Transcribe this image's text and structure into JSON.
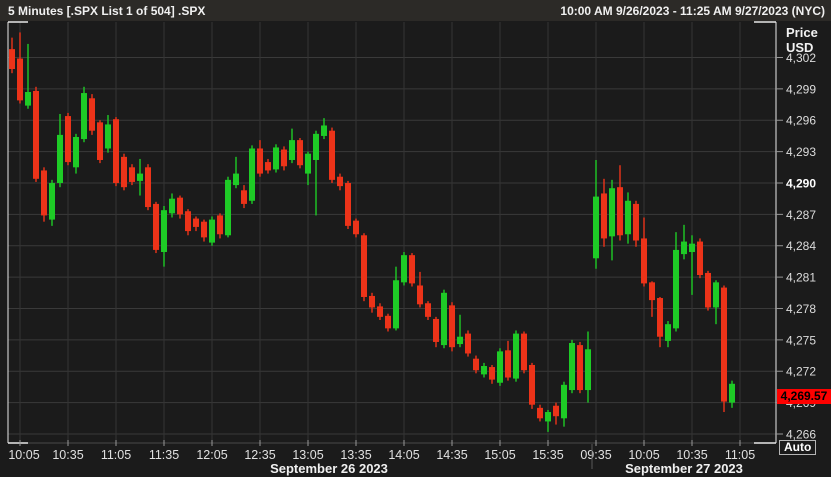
{
  "window": {
    "title": "5 Minutes [.SPX List 1 of 504] .SPX",
    "date_range": "10:00 AM 9/26/2023 - 11:25 AM 9/27/2023 (NYC)"
  },
  "price_axis": {
    "title_line1": "Price",
    "title_line2": "USD",
    "emphasized_tick": "4,290",
    "last_price": "4,269.57",
    "auto_button": "Auto",
    "ticks": [
      {
        "price": 4302,
        "label": "4,302"
      },
      {
        "price": 4299,
        "label": "4,299"
      },
      {
        "price": 4296,
        "label": "4,296"
      },
      {
        "price": 4293,
        "label": "4,293"
      },
      {
        "price": 4290,
        "label": "4,290"
      },
      {
        "price": 4287,
        "label": "4,287"
      },
      {
        "price": 4284,
        "label": "4,284"
      },
      {
        "price": 4281,
        "label": "4,281"
      },
      {
        "price": 4278,
        "label": "4,278"
      },
      {
        "price": 4275,
        "label": "4,275"
      },
      {
        "price": 4272,
        "label": "4,272"
      },
      {
        "price": 4269,
        "label": "4,269"
      },
      {
        "price": 4266,
        "label": "4,266"
      }
    ]
  },
  "time_axis": {
    "ticks": [
      {
        "slot": 1,
        "label": "10:05"
      },
      {
        "slot": 7,
        "label": "10:35"
      },
      {
        "slot": 13,
        "label": "11:05"
      },
      {
        "slot": 19,
        "label": "11:35"
      },
      {
        "slot": 25,
        "label": "12:05"
      },
      {
        "slot": 31,
        "label": "12:35"
      },
      {
        "slot": 37,
        "label": "13:05"
      },
      {
        "slot": 43,
        "label": "13:35"
      },
      {
        "slot": 49,
        "label": "14:05"
      },
      {
        "slot": 55,
        "label": "14:35"
      },
      {
        "slot": 61,
        "label": "15:05"
      },
      {
        "slot": 67,
        "label": "15:35"
      },
      {
        "slot": 73,
        "label": "09:35"
      },
      {
        "slot": 79,
        "label": "10:05"
      },
      {
        "slot": 85,
        "label": "10:35"
      },
      {
        "slot": 91,
        "label": "11:05"
      }
    ],
    "sessions": [
      {
        "date_label": "September 26 2023"
      },
      {
        "date_label": "September 27 2023"
      }
    ],
    "session_break_after_slot": 72
  },
  "colors": {
    "background": "#1b1b1b",
    "header_bg": "#2c2a27",
    "up": "#1ecb26",
    "down": "#ec3319",
    "grid_h": "#3a3a3a",
    "grid_v": "#343434",
    "frame": "#e8e8e8",
    "axis_line": "#4a4a4a",
    "tick_mark": "#979797",
    "tick_text": "#dcdcdc",
    "badge_bg": "#fe0100",
    "badge_text": "#000000"
  },
  "chart_data": {
    "type": "candlestick",
    "instrument": ".SPX",
    "interval": "5 Minutes",
    "price_unit": "USD",
    "ylim": [
      4265.1,
      4305.4
    ],
    "total_slots": 96,
    "columns": [
      "time",
      "open",
      "high",
      "low",
      "close"
    ],
    "candles": [
      [
        "10:00",
        4302.8,
        4303.9,
        4300.5,
        4300.9
      ],
      [
        "10:05",
        4301.9,
        4304.4,
        4297.6,
        4297.9
      ],
      [
        "10:10",
        4297.4,
        4303.3,
        4297.1,
        4298.7
      ],
      [
        "10:15",
        4298.8,
        4299.2,
        4290.1,
        4290.4
      ],
      [
        "10:20",
        4291.2,
        4291.5,
        4286.3,
        4286.9
      ],
      [
        "10:25",
        4286.5,
        4290.3,
        4285.9,
        4290.0
      ],
      [
        "10:30",
        4290.0,
        4296.6,
        4289.6,
        4294.6
      ],
      [
        "10:35",
        4296.4,
        4296.7,
        4291.7,
        4292.0
      ],
      [
        "10:40",
        4291.5,
        4294.7,
        4290.9,
        4294.4
      ],
      [
        "10:45",
        4294.2,
        4299.2,
        4293.9,
        4298.6
      ],
      [
        "10:50",
        4298.1,
        4298.5,
        4294.6,
        4295.0
      ],
      [
        "10:55",
        4295.8,
        4296.0,
        4291.9,
        4292.2
      ],
      [
        "11:00",
        4293.3,
        4296.5,
        4292.9,
        4295.6
      ],
      [
        "11:05",
        4296.1,
        4296.3,
        4289.7,
        4290.0
      ],
      [
        "11:10",
        4292.5,
        4292.8,
        4289.3,
        4289.6
      ],
      [
        "11:15",
        4291.5,
        4291.8,
        4289.8,
        4290.1
      ],
      [
        "11:20",
        4290.2,
        4292.3,
        4288.8,
        4290.9
      ],
      [
        "11:25",
        4291.5,
        4291.8,
        4287.4,
        4287.7
      ],
      [
        "11:30",
        4288.0,
        4288.2,
        4283.3,
        4283.6
      ],
      [
        "11:35",
        4283.4,
        4287.8,
        4282.0,
        4287.4
      ],
      [
        "11:40",
        4287.1,
        4289.0,
        4286.7,
        4288.5
      ],
      [
        "11:45",
        4288.6,
        4288.8,
        4286.6,
        4287.0
      ],
      [
        "11:50",
        4287.3,
        4287.5,
        4285.0,
        4285.4
      ],
      [
        "11:55",
        4286.6,
        4286.8,
        4285.4,
        4285.8
      ],
      [
        "12:00",
        4286.3,
        4286.5,
        4284.4,
        4284.8
      ],
      [
        "12:05",
        4284.3,
        4286.8,
        4284.0,
        4286.5
      ],
      [
        "12:10",
        4286.9,
        4287.1,
        4284.7,
        4285.1
      ],
      [
        "12:15",
        4285.0,
        4290.6,
        4284.8,
        4290.3
      ],
      [
        "12:20",
        4289.8,
        4292.5,
        4289.5,
        4290.9
      ],
      [
        "12:25",
        4289.3,
        4289.8,
        4287.6,
        4288.0
      ],
      [
        "12:30",
        4288.3,
        4293.6,
        4288.0,
        4293.3
      ],
      [
        "12:35",
        4293.3,
        4294.1,
        4290.6,
        4290.9
      ],
      [
        "12:40",
        4292.0,
        4292.3,
        4290.9,
        4291.2
      ],
      [
        "12:45",
        4291.3,
        4293.7,
        4291.0,
        4293.4
      ],
      [
        "12:50",
        4293.2,
        4293.5,
        4291.2,
        4291.6
      ],
      [
        "12:55",
        4292.2,
        4295.2,
        4291.9,
        4294.1
      ],
      [
        "13:00",
        4294.1,
        4294.3,
        4291.4,
        4291.7
      ],
      [
        "13:05",
        4290.9,
        4293.0,
        4289.8,
        4292.8
      ],
      [
        "13:10",
        4292.2,
        4295.0,
        4286.9,
        4294.7
      ],
      [
        "13:15",
        4294.5,
        4296.2,
        4294.2,
        4295.5
      ],
      [
        "13:20",
        4295.0,
        4295.3,
        4290.0,
        4290.3
      ],
      [
        "13:25",
        4290.6,
        4290.9,
        4289.3,
        4289.7
      ],
      [
        "13:30",
        4290.0,
        4290.2,
        4285.6,
        4285.9
      ],
      [
        "13:35",
        4286.4,
        4286.6,
        4284.8,
        4285.1
      ],
      [
        "13:40",
        4285.0,
        4285.2,
        4278.7,
        4279.1
      ],
      [
        "13:45",
        4279.2,
        4279.5,
        4277.6,
        4278.1
      ],
      [
        "13:50",
        4278.2,
        4278.5,
        4276.9,
        4277.2
      ],
      [
        "13:55",
        4277.3,
        4277.5,
        4275.8,
        4276.1
      ],
      [
        "14:00",
        4276.1,
        4282.0,
        4275.9,
        4280.7
      ],
      [
        "14:05",
        4280.5,
        4283.4,
        4280.2,
        4283.1
      ],
      [
        "14:10",
        4283.1,
        4283.3,
        4280.1,
        4280.4
      ],
      [
        "14:15",
        4280.2,
        4281.5,
        4278.1,
        4278.4
      ],
      [
        "14:20",
        4278.5,
        4278.7,
        4276.9,
        4277.2
      ],
      [
        "14:25",
        4277.0,
        4277.2,
        4274.3,
        4274.8
      ],
      [
        "14:30",
        4274.5,
        4279.8,
        4274.2,
        4279.5
      ],
      [
        "14:35",
        4278.3,
        4278.6,
        4273.9,
        4274.3
      ],
      [
        "14:40",
        4274.6,
        4277.4,
        4274.3,
        4275.3
      ],
      [
        "14:45",
        4275.6,
        4275.9,
        4273.4,
        4273.7
      ],
      [
        "14:50",
        4273.2,
        4273.5,
        4271.8,
        4272.1
      ],
      [
        "14:55",
        4271.7,
        4272.8,
        4271.4,
        4272.5
      ],
      [
        "15:00",
        4272.4,
        4272.6,
        4270.8,
        4271.2
      ],
      [
        "15:05",
        4270.9,
        4274.2,
        4270.6,
        4273.9
      ],
      [
        "15:10",
        4274.0,
        4274.9,
        4271.1,
        4271.4
      ],
      [
        "15:15",
        4271.3,
        4275.9,
        4271.0,
        4275.6
      ],
      [
        "15:20",
        4275.6,
        4275.8,
        4271.8,
        4272.1
      ],
      [
        "15:25",
        4272.6,
        4272.8,
        4268.4,
        4268.8
      ],
      [
        "15:30",
        4268.5,
        4268.8,
        4267.2,
        4267.5
      ],
      [
        "15:35",
        4267.2,
        4268.3,
        4266.2,
        4268.1
      ],
      [
        "15:40",
        4268.7,
        4269.0,
        4266.9,
        4267.7
      ],
      [
        "15:45",
        4267.5,
        4271.0,
        4266.7,
        4270.7
      ],
      [
        "15:50",
        4270.2,
        4275.0,
        4269.9,
        4274.7
      ],
      [
        "15:55",
        4274.5,
        4274.8,
        4269.9,
        4270.2
      ],
      [
        "16:00",
        4270.2,
        4275.8,
        4269.0,
        4274.1
      ],
      [
        "09:35",
        4282.8,
        4292.2,
        4281.8,
        4288.7
      ],
      [
        "09:40",
        4289.0,
        4290.4,
        4283.9,
        4284.7
      ],
      [
        "09:45",
        4284.9,
        4290.3,
        4282.6,
        4289.5
      ],
      [
        "09:50",
        4289.6,
        4291.7,
        4284.5,
        4285.0
      ],
      [
        "09:55",
        4285.1,
        4289.1,
        4284.2,
        4288.3
      ],
      [
        "10:00",
        4288.0,
        4288.3,
        4283.9,
        4284.5
      ],
      [
        "10:05",
        4284.7,
        4286.7,
        4280.1,
        4280.4
      ],
      [
        "10:10",
        4280.5,
        4280.6,
        4277.2,
        4278.8
      ],
      [
        "10:15",
        4279.0,
        4279.1,
        4274.3,
        4275.3
      ],
      [
        "10:20",
        4274.9,
        4276.8,
        4274.3,
        4276.5
      ],
      [
        "10:25",
        4276.1,
        4285.3,
        4275.8,
        4283.6
      ],
      [
        "10:30",
        4283.2,
        4286.0,
        4282.7,
        4284.4
      ],
      [
        "10:35",
        4283.4,
        4285.0,
        4279.3,
        4284.2
      ],
      [
        "10:40",
        4284.4,
        4284.7,
        4280.9,
        4281.2
      ],
      [
        "10:45",
        4281.4,
        4281.6,
        4277.8,
        4278.1
      ],
      [
        "10:50",
        4278.1,
        4280.7,
        4276.5,
        4280.5
      ],
      [
        "10:55",
        4280.0,
        4280.2,
        4268.1,
        4269.1
      ],
      [
        "11:00",
        4269.0,
        4271.1,
        4268.5,
        4270.8
      ]
    ],
    "last_trade_price": 4269.57
  }
}
